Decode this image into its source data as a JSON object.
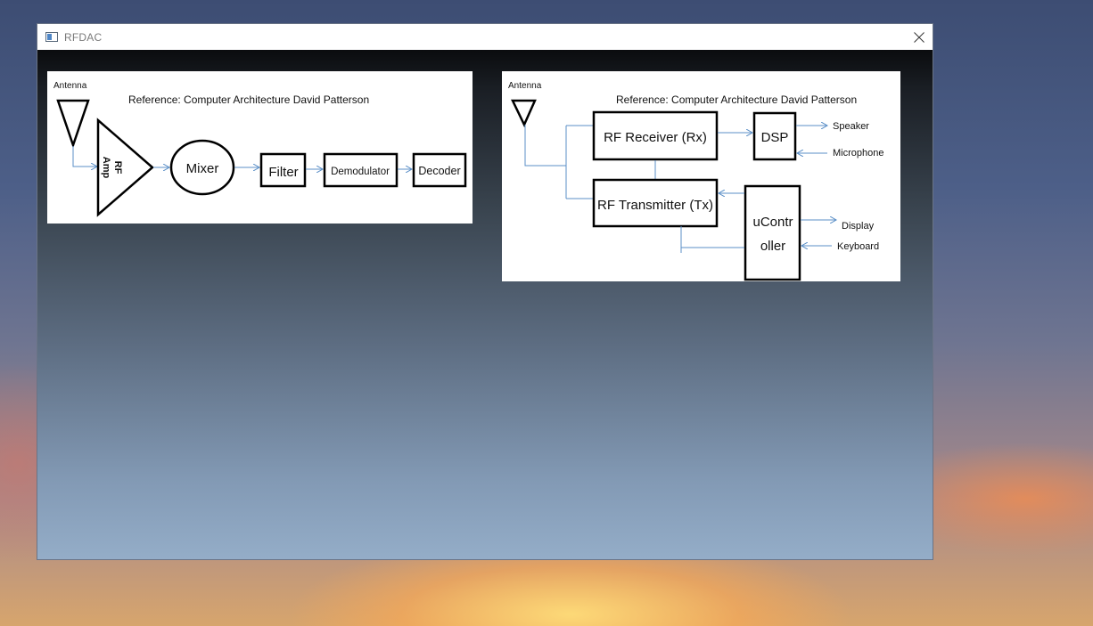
{
  "window": {
    "title": "RFDAC",
    "app_icon": "window-app-icon",
    "close_icon": "close-icon"
  },
  "diagram1": {
    "antenna_label": "Antenna",
    "reference": "Reference: Computer Architecture David Patterson",
    "amp_label_line1": "RF",
    "amp_label_line2": "Amp",
    "mixer": "Mixer",
    "filter": "Filter",
    "demodulator": "Demodulator",
    "decoder": "Decoder"
  },
  "diagram2": {
    "antenna_label": "Antenna",
    "reference": "Reference: Computer Architecture David Patterson",
    "receiver": "RF Receiver (Rx)",
    "transmitter": "RF Transmitter (Tx)",
    "dsp": "DSP",
    "controller_line1": "uContr",
    "controller_line2": "oller",
    "speaker": "Speaker",
    "microphone": "Microphone",
    "display": "Display",
    "keyboard": "Keyboard"
  },
  "colors": {
    "arrow": "#5b8fc7",
    "box_border": "#000000"
  }
}
